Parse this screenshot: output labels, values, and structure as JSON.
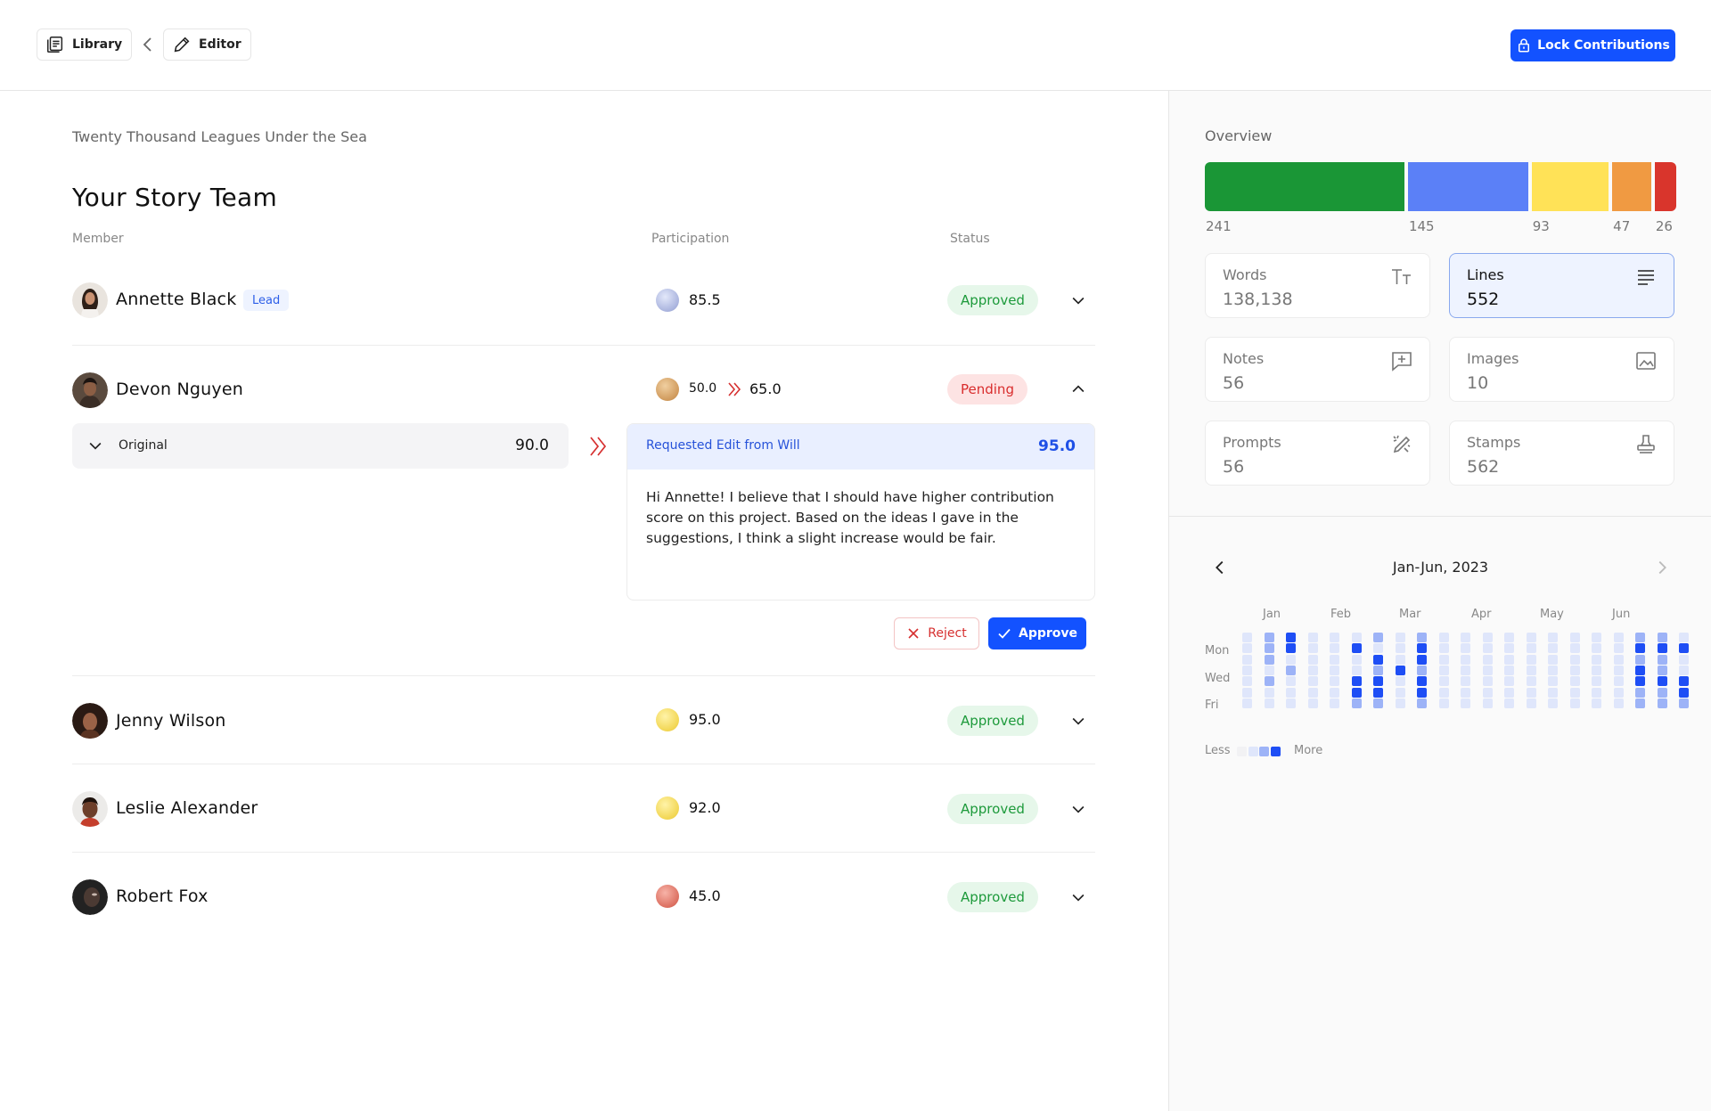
{
  "topbar": {
    "library_label": "Library",
    "editor_label": "Editor",
    "lock_label": "Lock Contributions"
  },
  "main": {
    "book_title": "Twenty Thousand Leagues Under the Sea",
    "team_title": "Your Story Team",
    "columns": {
      "member": "Member",
      "participation": "Participation",
      "status": "Status"
    },
    "members": [
      {
        "name": "Annette Black",
        "tag": "Lead",
        "score": "85.5",
        "status": "Approved",
        "coin_color": "#b9c2e6"
      },
      {
        "name": "Devon Nguyen",
        "score_from": "50.0",
        "score_to": "65.0",
        "status": "Pending",
        "coin_color": "#d6a56a"
      },
      {
        "name": "Jenny Wilson",
        "score": "95.0",
        "status": "Approved",
        "coin_color": "#f2dc63"
      },
      {
        "name": "Leslie Alexander",
        "score": "92.0",
        "status": "Approved",
        "coin_color": "#f2dc63"
      },
      {
        "name": "Robert Fox",
        "score": "45.0",
        "status": "Approved",
        "coin_color": "#e07a6a"
      }
    ],
    "expanded": {
      "original_label": "Original",
      "original_value": "90.0",
      "request_label": "Requested Edit from Will",
      "request_value": "95.0",
      "message": "Hi Annette! I believe that I should have higher  contribution score on this project. Based on the ideas I gave in the suggestions, I think a slight increase would be fair.",
      "reject_label": "Reject",
      "approve_label": "Approve"
    }
  },
  "side": {
    "overview_title": "Overview",
    "overview_bar": [
      {
        "value": 241,
        "color": "#1a9636"
      },
      {
        "value": 145,
        "color": "#5b80f7"
      },
      {
        "value": 93,
        "color": "#ffe257"
      },
      {
        "value": 47,
        "color": "#f09a42"
      },
      {
        "value": 26,
        "color": "#d9352c"
      }
    ],
    "overview_labels": [
      "241",
      "145",
      "93",
      "47",
      "26"
    ],
    "stats": [
      {
        "label": "Words",
        "value": "138,138",
        "icon": "text-size-icon"
      },
      {
        "label": "Lines",
        "value": "552",
        "icon": "lines-icon",
        "active": true
      },
      {
        "label": "Notes",
        "value": "56",
        "icon": "note-add-icon"
      },
      {
        "label": "Images",
        "value": "10",
        "icon": "image-icon"
      },
      {
        "label": "Prompts",
        "value": "56",
        "icon": "magic-pen-icon"
      },
      {
        "label": "Stamps",
        "value": "562",
        "icon": "stamp-icon"
      }
    ],
    "calendar": {
      "title": "Jan-Jun, 2023",
      "months": [
        "Jan",
        "Feb",
        "Mar",
        "Apr",
        "May",
        "Jun"
      ],
      "days": [
        "Mon",
        "Wed",
        "Fri"
      ],
      "legend_less": "Less",
      "legend_more": "More",
      "levels_colors": [
        "#f2f2f4",
        "#dfe6fb",
        "#9db3f7",
        "#1e4ef5"
      ],
      "grid": [
        [
          1,
          1,
          1,
          1,
          1,
          1,
          1
        ],
        [
          2,
          2,
          2,
          1,
          2,
          1,
          1
        ],
        [
          3,
          3,
          1,
          2,
          1,
          1,
          1
        ],
        [
          1,
          1,
          1,
          1,
          1,
          1,
          1
        ],
        [
          1,
          1,
          1,
          1,
          1,
          1,
          1
        ],
        [
          1,
          3,
          1,
          1,
          3,
          3,
          2
        ],
        [
          2,
          1,
          3,
          2,
          3,
          3,
          2
        ],
        [
          1,
          1,
          1,
          3,
          1,
          1,
          1
        ],
        [
          2,
          3,
          3,
          2,
          3,
          3,
          2
        ],
        [
          1,
          1,
          1,
          1,
          1,
          1,
          1
        ],
        [
          1,
          1,
          1,
          1,
          1,
          1,
          1
        ],
        [
          1,
          1,
          1,
          1,
          1,
          1,
          1
        ],
        [
          1,
          1,
          1,
          1,
          1,
          1,
          1
        ],
        [
          1,
          1,
          1,
          1,
          1,
          1,
          1
        ],
        [
          1,
          1,
          1,
          1,
          1,
          1,
          1
        ],
        [
          1,
          1,
          1,
          1,
          1,
          1,
          1
        ],
        [
          1,
          1,
          1,
          1,
          1,
          1,
          1
        ],
        [
          1,
          1,
          1,
          1,
          1,
          1,
          1
        ],
        [
          2,
          3,
          2,
          3,
          3,
          2,
          2
        ],
        [
          2,
          3,
          2,
          2,
          3,
          2,
          2
        ],
        [
          1,
          3,
          1,
          1,
          3,
          3,
          2
        ]
      ]
    }
  }
}
